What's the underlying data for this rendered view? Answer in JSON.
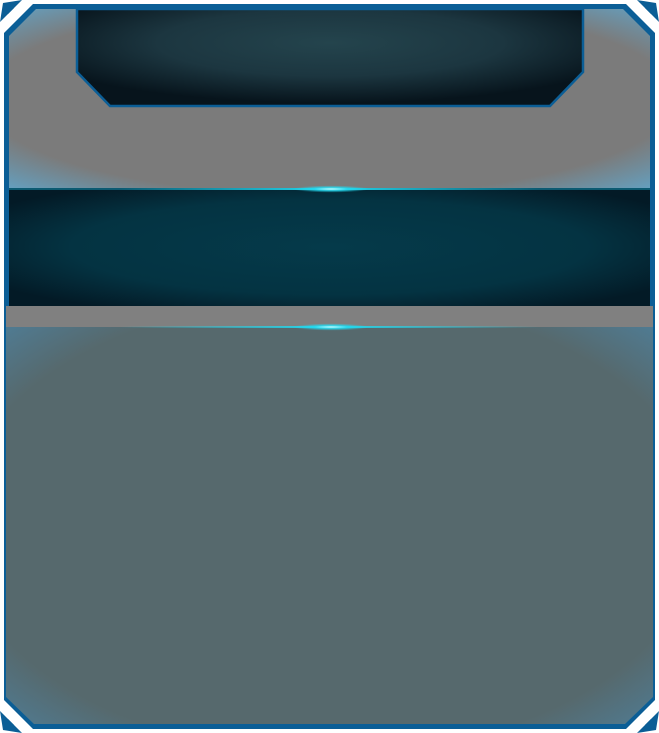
{
  "panel": {
    "theme": "sci-fi game window frame",
    "colors": {
      "frame_border": "#0b5e96",
      "frame_border_light": "#1a7fbf",
      "upper_fill": "#7b7b7b",
      "upper_edge_glow": "#5fa8cf",
      "title_slot_dark": "#07141c",
      "title_slot_mid": "#24444d",
      "band_dark": "#031a26",
      "band_mid": "#053a4a",
      "separator_gray": "#808080",
      "content_fill": "#56696d",
      "content_edge": "#4f7d96",
      "accent_glow": "#22d8ee"
    },
    "icons": {
      "corner_ornament": "corner-notch-icon",
      "divider_glow": "cyan-glow-line"
    }
  }
}
